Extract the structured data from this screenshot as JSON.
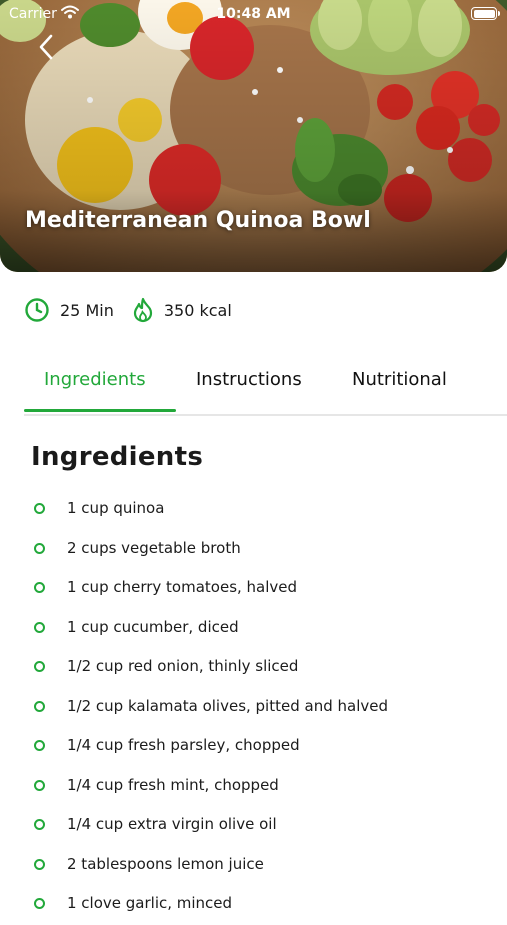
{
  "status_bar": {
    "carrier": "Carrier",
    "time": "10:48 AM"
  },
  "hero": {
    "title": "Mediterranean Quinoa Bowl"
  },
  "meta": {
    "time": "25 Min",
    "calories": "350 kcal"
  },
  "tabs": [
    {
      "label": "Ingredients",
      "active": true
    },
    {
      "label": "Instructions",
      "active": false
    },
    {
      "label": "Nutritional",
      "active": false
    }
  ],
  "section": {
    "title": "Ingredients"
  },
  "ingredients": [
    "1 cup quinoa",
    "2 cups vegetable broth",
    "1 cup cherry tomatoes, halved",
    "1 cup cucumber, diced",
    "1/2 cup red onion, thinly sliced",
    "1/2 cup kalamata olives, pitted and halved",
    "1/4 cup fresh parsley, chopped",
    "1/4 cup fresh mint, chopped",
    "1/4 cup extra virgin olive oil",
    "2 tablespoons lemon juice",
    "1 clove garlic, minced"
  ],
  "colors": {
    "accent": "#22a83a",
    "divider": "#e6e6e6"
  },
  "icons": {
    "back": "chevron-left-icon",
    "time": "clock-icon",
    "calories": "flame-icon",
    "bullet": "ring-bullet-icon"
  }
}
